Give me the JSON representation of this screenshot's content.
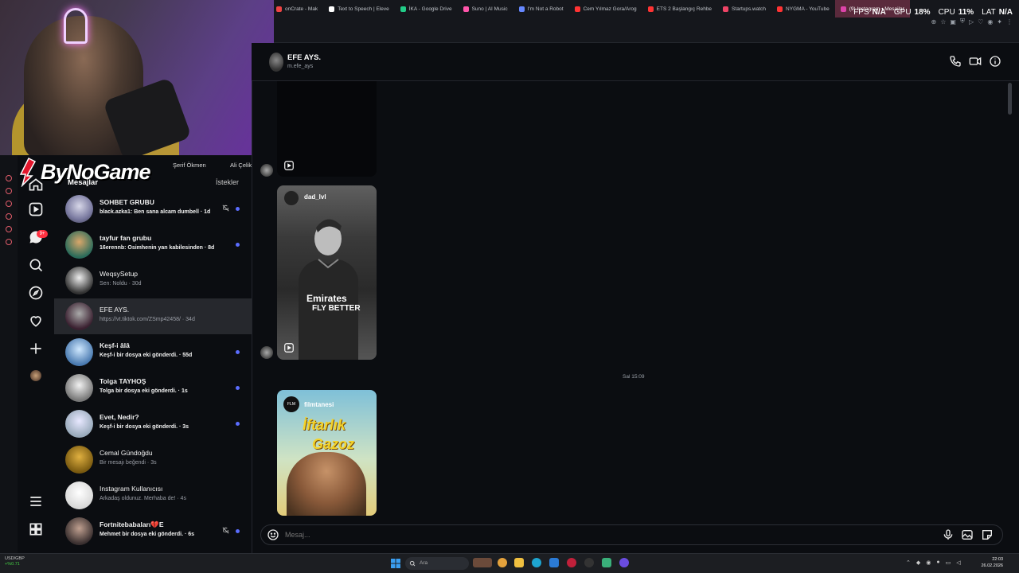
{
  "browser": {
    "tabs": [
      {
        "label": "onCrate - Mak",
        "color": "#e44"
      },
      {
        "label": "Text to Speech | Eleve",
        "color": "#fff"
      },
      {
        "label": "İKA - Google Drive",
        "color": "#2c8"
      },
      {
        "label": "Suno | AI Music",
        "color": "#f5a"
      },
      {
        "label": "I'm Not a Robot",
        "color": "#68f"
      },
      {
        "label": "Cem Yılmaz Gora/Arog",
        "color": "#f33"
      },
      {
        "label": "ETS 2 Başlangıç Rehbe",
        "color": "#f33"
      },
      {
        "label": "Startups.watch",
        "color": "#e46"
      },
      {
        "label": "NYGMA - YouTube",
        "color": "#f33"
      },
      {
        "label": "(9) Instagram • Mesajlar",
        "color": "#d4a"
      }
    ],
    "perf": [
      {
        "label": "FPS",
        "value": "N/A"
      },
      {
        "label": "GPU",
        "value": "18%"
      },
      {
        "label": "CPU",
        "value": "11%"
      },
      {
        "label": "LAT",
        "value": "N/A"
      }
    ]
  },
  "overlay": {
    "logo_text": "ByNoGame"
  },
  "stories": [
    {
      "label": "Şerif Ökmen"
    },
    {
      "label": "Ali Çelik"
    }
  ],
  "inbox": {
    "title": "Mesajlar",
    "requests_label": "İstekler",
    "notif_badge": "9+",
    "conversations": [
      {
        "name": "SOHBET GRUBU",
        "preview": "black.azka1: Ben sana alcam dumbell · 1d",
        "unread": true,
        "muted": true,
        "bold_preview": true
      },
      {
        "name": "tayfur fan grubu",
        "preview": "16erennb: Osimhenin yan kabilesinden · 8d",
        "unread": true,
        "muted": false,
        "bold_preview": true
      },
      {
        "name": "WeqsySetup",
        "preview": "Sen: Noldu · 30d",
        "unread": false,
        "muted": false,
        "bold_preview": false
      },
      {
        "name": "EFE AYS.",
        "preview": "https://vt.tiktok.com/ZSmp42458/ · 34d",
        "unread": false,
        "muted": false,
        "bold_preview": false
      },
      {
        "name": "Keşf-i âlâ",
        "preview": "Keşf-i bir dosya eki gönderdi. · 55d",
        "unread": true,
        "muted": false,
        "bold_preview": true
      },
      {
        "name": "Tolga TAYHOŞ",
        "preview": "Tolga bir dosya eki gönderdi. · 1s",
        "unread": true,
        "muted": false,
        "bold_preview": true
      },
      {
        "name": "Evet, Nedir?",
        "preview": "Keşf-i bir dosya eki gönderdi. · 3s",
        "unread": true,
        "muted": false,
        "bold_preview": true
      },
      {
        "name": "Cemal Gündoğdu",
        "preview": "Bir mesajı beğendi · 3s",
        "unread": false,
        "muted": false,
        "bold_preview": false
      },
      {
        "name": "Instagram Kullanıcısı",
        "preview": "Arkadaş oldunuz. Merhaba de! · 4s",
        "unread": false,
        "muted": false,
        "bold_preview": false
      },
      {
        "name": "Fortnitebabaları💔E",
        "preview": "Mehmet bir dosya eki gönderdi. · 6s",
        "unread": true,
        "muted": true,
        "bold_preview": true
      }
    ]
  },
  "chat": {
    "name": "EFE AYS.",
    "username": "m.efe_ays",
    "time_separator": "Sal 15:09",
    "media": [
      {
        "user": "dad_lvl",
        "shirt_line1": "Emirates",
        "shirt_line2": "FLY BETTER"
      },
      {
        "user": "filmtanesi",
        "avatar_text": "FLM",
        "title_line1": "İftarlık",
        "title_line2": "Gazoz"
      }
    ],
    "composer_placeholder": "Mesaj..."
  },
  "taskbar": {
    "ticker_line1": "USD/GBP",
    "ticker_line2": "+%0.71",
    "search_label": "Ara",
    "clock_time": "22:03",
    "clock_date": "26.02.2026"
  }
}
